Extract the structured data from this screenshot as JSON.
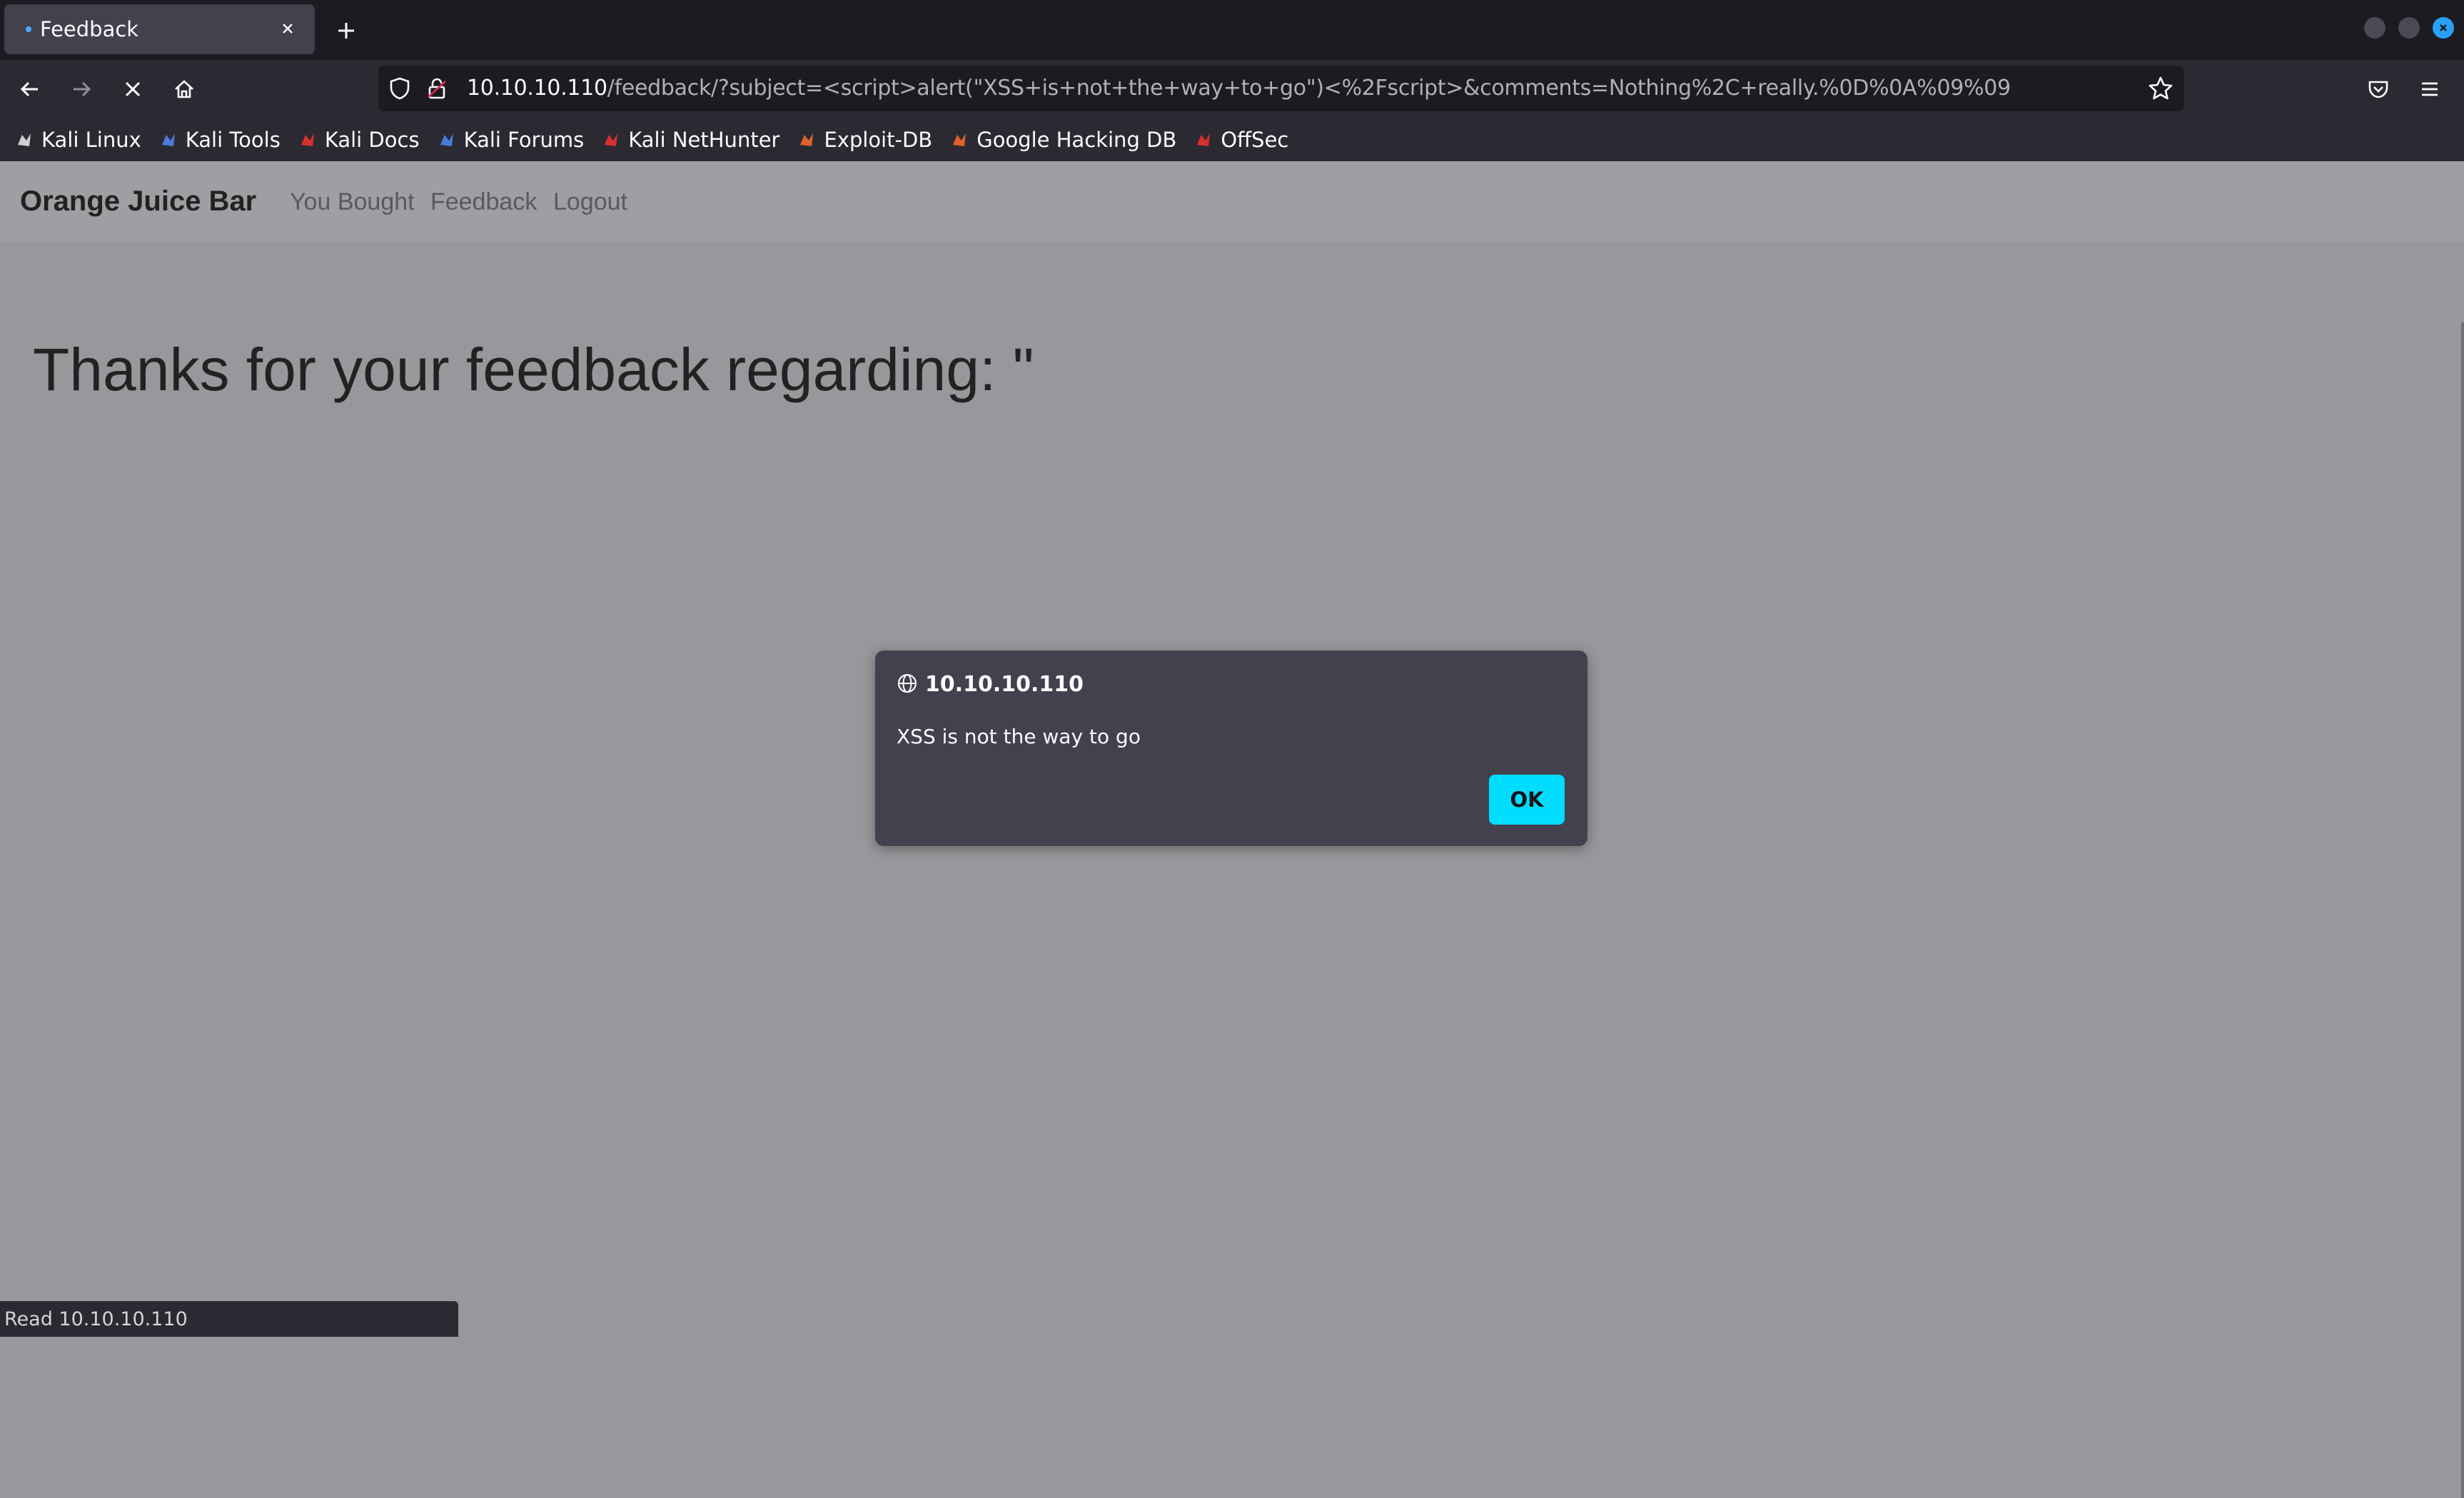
{
  "browser": {
    "tab": {
      "title": "Feedback"
    },
    "url": {
      "host": "10.10.10.110",
      "path": "/feedback/?subject=<script>alert(\"XSS+is+not+the+way+to+go\")<%2Fscript>&comments=Nothing%2C+really.%0D%0A%09%09"
    },
    "bookmarks": [
      {
        "label": "Kali Linux",
        "icon": "kali-dragon-icon",
        "color": "#cfcfd4"
      },
      {
        "label": "Kali Tools",
        "icon": "kali-tools-icon",
        "color": "#4b7bd8"
      },
      {
        "label": "Kali Docs",
        "icon": "kali-docs-icon",
        "color": "#d9302b"
      },
      {
        "label": "Kali Forums",
        "icon": "kali-forums-icon",
        "color": "#4b7bd8"
      },
      {
        "label": "Kali NetHunter",
        "icon": "nethunter-icon",
        "color": "#d9302b"
      },
      {
        "label": "Exploit-DB",
        "icon": "exploit-db-icon",
        "color": "#e0622b"
      },
      {
        "label": "Google Hacking DB",
        "icon": "ghdb-icon",
        "color": "#e0622b"
      },
      {
        "label": "OffSec",
        "icon": "offsec-icon",
        "color": "#d9302b"
      }
    ],
    "status": "Read 10.10.10.110"
  },
  "site": {
    "brand": "Orange Juice Bar",
    "nav": [
      "You Bought",
      "Feedback",
      "Logout"
    ],
    "heading": "Thanks for your feedback regarding: \""
  },
  "dialog": {
    "origin": "10.10.10.110",
    "message": "XSS is not the way to go",
    "ok_label": "OK"
  },
  "colors": {
    "accent": "#00ddff",
    "toolbar": "#2b2a33",
    "page_overlay": "#98989c"
  }
}
